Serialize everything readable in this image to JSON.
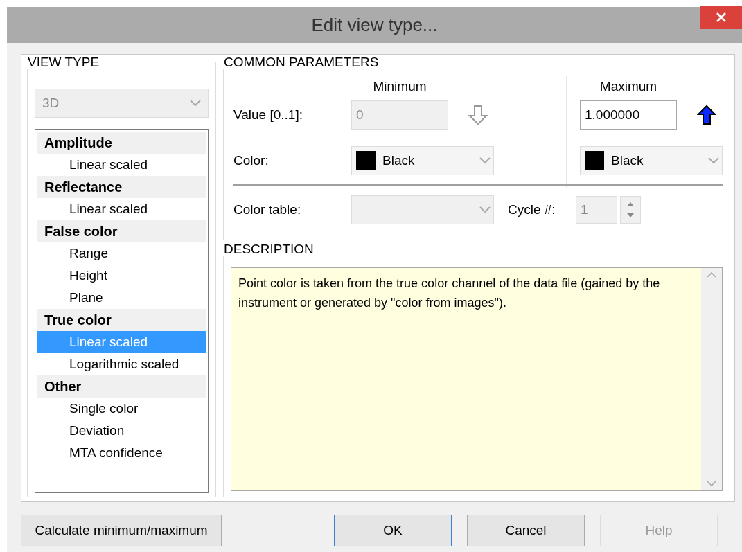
{
  "window": {
    "title": "Edit view type..."
  },
  "view_type": {
    "title": "VIEW TYPE",
    "dropdown": {
      "value": "3D",
      "disabled": true
    },
    "groups": [
      {
        "label": "Amplitude",
        "children": [
          {
            "label": "Linear scaled",
            "selected": false
          }
        ]
      },
      {
        "label": "Reflectance",
        "children": [
          {
            "label": "Linear scaled",
            "selected": false
          }
        ]
      },
      {
        "label": "False color",
        "children": [
          {
            "label": "Range",
            "selected": false
          },
          {
            "label": "Height",
            "selected": false
          },
          {
            "label": "Plane",
            "selected": false
          }
        ]
      },
      {
        "label": "True color",
        "children": [
          {
            "label": "Linear scaled",
            "selected": true
          },
          {
            "label": "Logarithmic scaled",
            "selected": false
          }
        ]
      },
      {
        "label": "Other",
        "children": [
          {
            "label": "Single color",
            "selected": false
          },
          {
            "label": "Deviation",
            "selected": false
          },
          {
            "label": "MTA confidence",
            "selected": false
          }
        ]
      }
    ]
  },
  "common_parameters": {
    "title": "COMMON PARAMETERS",
    "minimum_heading": "Minimum",
    "maximum_heading": "Maximum",
    "value_label": "Value [0..1]:",
    "color_label": "Color:",
    "minimum": {
      "value": "0",
      "disabled": true,
      "color_name": "Black",
      "color": "#000000"
    },
    "maximum": {
      "value": "1.000000",
      "disabled": false,
      "color_name": "Black",
      "color": "#000000"
    },
    "color_table_label": "Color table:",
    "color_table_disabled": true,
    "cycle_label": "Cycle #:",
    "cycle_value": "1",
    "cycle_disabled": true
  },
  "description": {
    "title": "DESCRIPTION",
    "text": "Point color is taken from the true color channel of the data file (gained by the instrument or generated by \"color from images\")."
  },
  "buttons": [
    {
      "label": "Calculate minimum/maximum",
      "disabled": false,
      "default": false
    },
    {
      "label": "OK",
      "disabled": false,
      "default": true
    },
    {
      "label": "Cancel",
      "disabled": false,
      "default": false
    },
    {
      "label": "Help",
      "disabled": true,
      "default": false
    }
  ]
}
